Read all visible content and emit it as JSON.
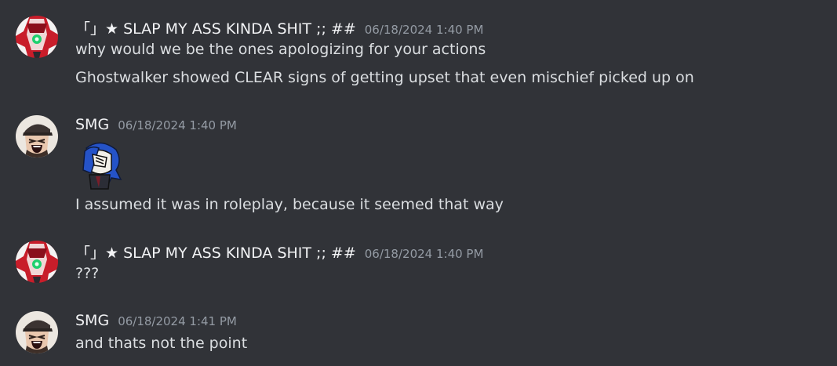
{
  "messages": [
    {
      "username": "「」★ SLAP MY ASS KINDA SHIT ;; ##",
      "timestamp": "06/18/2024 1:40 PM",
      "avatar": "red-green-anime-avatar",
      "lines": [
        "why would we be the ones apologizing for your actions",
        "Ghostwalker showed CLEAR signs of getting upset that even mischief picked up on"
      ]
    },
    {
      "username": "SMG",
      "timestamp": "06/18/2024 1:40 PM",
      "avatar": "laughing-man-cap-avatar",
      "sticker": "blue-hair-facepalm-character",
      "lines": [
        "I assumed it was in roleplay, because it seemed that way"
      ]
    },
    {
      "username": "「」★ SLAP MY ASS KINDA SHIT ;; ##",
      "timestamp": "06/18/2024 1:40 PM",
      "avatar": "red-green-anime-avatar",
      "lines": [
        "???"
      ]
    },
    {
      "username": "SMG",
      "timestamp": "06/18/2024 1:41 PM",
      "avatar": "laughing-man-cap-avatar",
      "lines": [
        "and thats not the point"
      ]
    }
  ]
}
